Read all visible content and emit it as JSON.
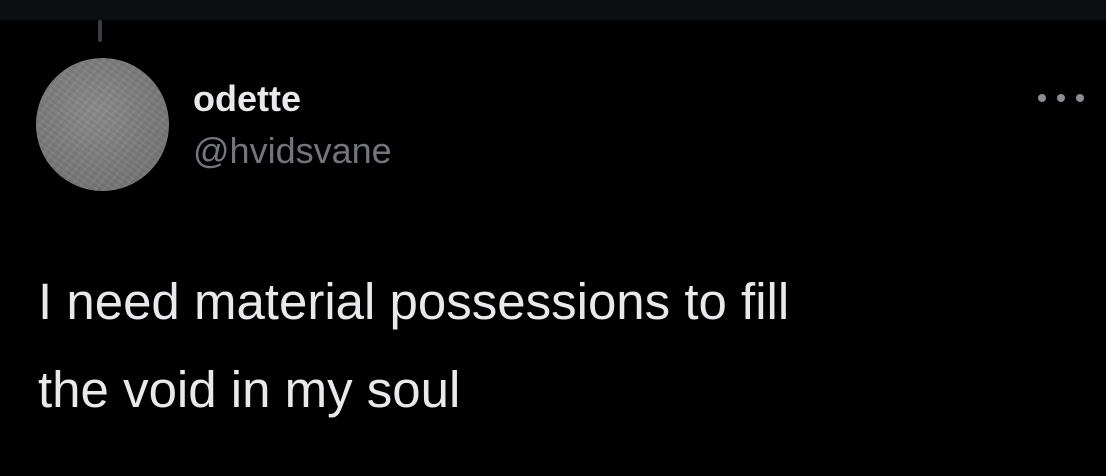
{
  "tweet": {
    "author": {
      "display_name": "odette",
      "handle": "@hvidsvane"
    },
    "text": "I need material possessions to fill\nthe void in my soul",
    "more_icon": "more-horizontal-icon"
  },
  "theme": {
    "background": "#000000",
    "text_primary": "#e7e9ea",
    "text_secondary": "#71767b"
  }
}
